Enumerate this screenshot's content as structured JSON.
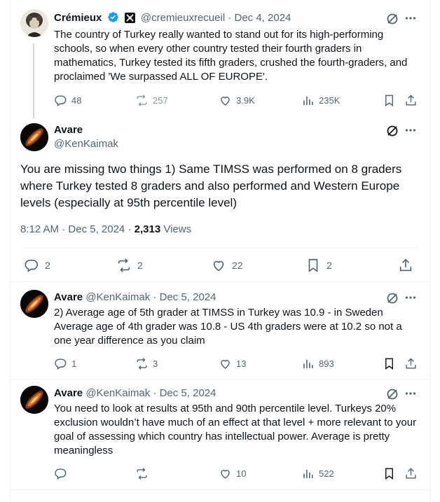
{
  "tweets": {
    "cremieux": {
      "name": "Crémieux",
      "handle": "@cremieuxrecueil",
      "date": "Dec 4, 2024",
      "text": "The country of Turkey really wanted to stand out for its high-performing schools, so when every other country tested their fourth graders in mathematics, Turkey tested its fifth graders, crushed the fourth-graders, and proclaimed 'We surpassed ALL OF EUROPE'.",
      "replies": "48",
      "reposts": "257",
      "likes": "3.9K",
      "views": "235K"
    },
    "main": {
      "name": "Avare",
      "handle": "@KenKaimak",
      "text": "You are missing two things 1) Same TIMSS was performed on 8 graders where Turkey tested 8 graders and also performed and Western Europe levels (especially at 95th percentile level)",
      "time": "8:12 AM",
      "date": "Dec 5, 2024",
      "views_count": "2,313",
      "views_label": "Views",
      "replies": "2",
      "reposts": "2",
      "likes": "22",
      "bookmarks": "2"
    },
    "reply1": {
      "name": "Avare",
      "handle": "@KenKaimak",
      "date": "Dec 5, 2024",
      "text": "2) Average age of 5th grader at TIMSS in Turkey was 10.9 - in Sweden Average age of 4th grader was 10.8 - US 4th graders were at 10.2 so not a one year difference as you claim",
      "replies": "1",
      "reposts": "3",
      "likes": "13",
      "views": "893"
    },
    "reply2": {
      "name": "Avare",
      "handle": "@KenKaimak",
      "date": "Dec 5, 2024",
      "text": "You need to look at results at 95th and 90th percentile level. Turkeys 20% exclusion wouldn’t have much of an effect at that level + more relevant to your goal of assessing which country has intellectual power. Average is pretty meaningless",
      "likes": "10",
      "views": "522"
    }
  },
  "separator": "·",
  "colors": {
    "text": "#0f1419",
    "muted": "#536471",
    "verified": "#1d9bf0",
    "border": "#eff3f4"
  }
}
